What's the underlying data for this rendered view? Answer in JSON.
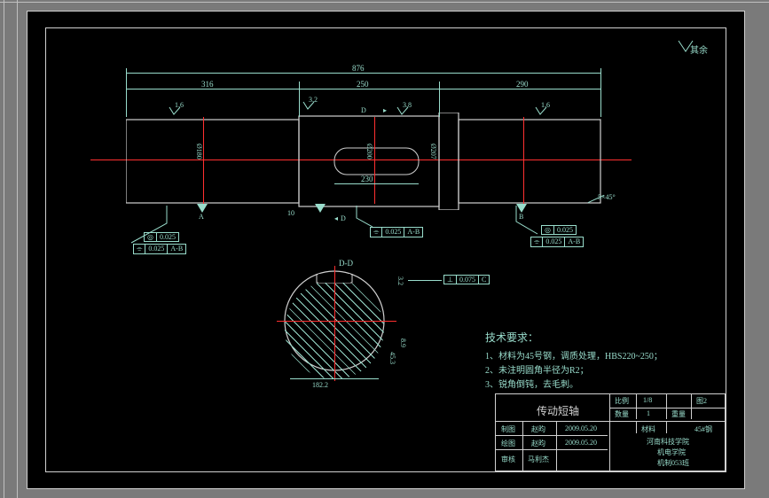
{
  "dimensions": {
    "overall": "876",
    "seg1": "316",
    "seg2": "250",
    "seg3": "290",
    "keyway": "230",
    "gap": "10",
    "section_width": "182.2",
    "section_h1": "3.2",
    "section_h2": "8.9",
    "section_h3": "45.3",
    "chamfer": "5×45°",
    "upper_rough_left": "1.6",
    "upper_rough_mid": "3.2",
    "upper_rough_right": "3.8",
    "upper_rough_far": "1.6",
    "arrow_D": "D",
    "dia_left": "Ø180",
    "dia_mid": "Ø200",
    "dia_right": "Ø207"
  },
  "tolerances": {
    "t1_sym": "◎",
    "t1_val": "0.025",
    "t2_sym": "⌯",
    "t2_val": "0.025",
    "t2_ref": "A-B",
    "t3_sym": "⌯",
    "t3_val": "0.025",
    "t3_ref": "A-B",
    "t4_sym": "◎",
    "t4_val": "0.025",
    "t5_sym": "⌯",
    "t5_val": "0.025",
    "t5_ref": "A-B",
    "t6_sym": "⊥",
    "t6_val": "0.075",
    "t6_ref": "C"
  },
  "datums": {
    "A": "A",
    "B": "B",
    "C": "C"
  },
  "section_label": "D-D",
  "markers": {
    "top_right": "其余"
  },
  "tech_req": {
    "heading": "技术要求：",
    "l1": "1、材料为45号钢，调质处理，HBS220~250；",
    "l2": "2、未注明圆角半径为R2；",
    "l3": "3、锐角倒钝，去毛刺。"
  },
  "title_block": {
    "part_name": "传动短轴",
    "scale_lbl": "比例",
    "scale_val": "1/8",
    "qty_lbl": "数量",
    "qty_val": "1",
    "weight_lbl": "重量",
    "fig_lbl": "图2",
    "mat_lbl": "材料",
    "mat_val": "45#钢",
    "role_draw": "制图",
    "role_design": "绘图",
    "role_check": "审核",
    "name1": "赵昀",
    "name2": "赵昀",
    "name3": "马利杰",
    "date1": "2009.05.20",
    "date2": "2009.05.20",
    "org1": "河南科技学院",
    "org2": "机电学院",
    "org3": "机制053班"
  }
}
